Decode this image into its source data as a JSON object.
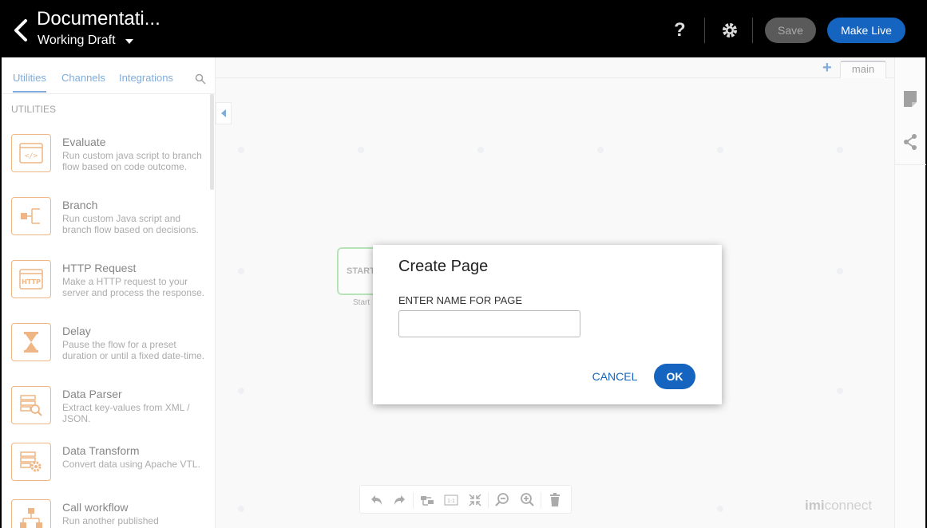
{
  "header": {
    "title": "Documentati...",
    "subtitle": "Working Draft",
    "help_label": "?",
    "save_label": "Save",
    "make_live_label": "Make Live"
  },
  "sidebar": {
    "tabs": [
      {
        "label": "Utilities",
        "active": true
      },
      {
        "label": "Channels",
        "active": false
      },
      {
        "label": "Integrations",
        "active": false
      }
    ],
    "section_label": "UTILITIES",
    "items": [
      {
        "title": "Evaluate",
        "desc": "Run custom java script to branch flow based on code outcome.",
        "icon": "code-window-icon"
      },
      {
        "title": "Branch",
        "desc": "Run custom Java script and branch flow based on decisions.",
        "icon": "branch-icon"
      },
      {
        "title": "HTTP Request",
        "desc": "Make a HTTP request to your server and process the response.",
        "icon": "http-icon"
      },
      {
        "title": "Delay",
        "desc": "Pause the flow for a preset duration or until a fixed date-time.",
        "icon": "hourglass-icon"
      },
      {
        "title": "Data Parser",
        "desc": "Extract key-values from XML / JSON.",
        "icon": "data-parser-icon"
      },
      {
        "title": "Data Transform",
        "desc": "Convert data using Apache VTL.",
        "icon": "data-transform-icon"
      },
      {
        "title": "Call workflow",
        "desc": "Run another published",
        "icon": "hierarchy-icon"
      }
    ]
  },
  "canvas": {
    "page_tab": "main",
    "start_node_text": "START",
    "start_label": "Start",
    "brand_strong": "imi",
    "brand_light": "connect"
  },
  "dialog": {
    "title": "Create Page",
    "label": "ENTER NAME FOR PAGE",
    "input_value": "",
    "input_placeholder": "",
    "cancel_label": "CANCEL",
    "ok_label": "OK"
  },
  "colors": {
    "accent": "#1464c0",
    "icon_orange": "#e07b20",
    "start_green": "#7ccc7c"
  }
}
